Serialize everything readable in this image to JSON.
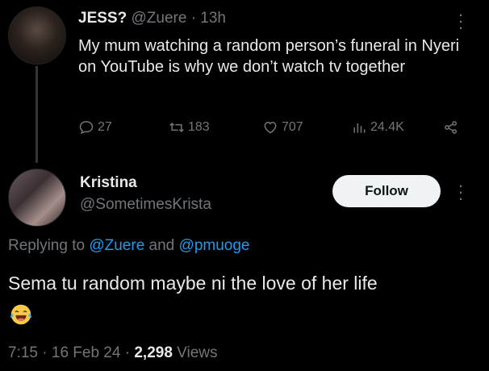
{
  "parent_tweet": {
    "display_name": "JESS?",
    "handle": "@Zuere",
    "separator": "·",
    "time": "13h",
    "text": "My mum watching a random person’s funeral in Nyeri on YouTube is why we don’t watch tv together",
    "actions": {
      "replies": "27",
      "retweets": "183",
      "likes": "707",
      "views": "24.4K"
    }
  },
  "reply_tweet": {
    "display_name": "Kristina",
    "handle": "@SometimesKrista",
    "follow_label": "Follow",
    "replying_prefix": "Replying to",
    "replying_to_1": "@Zuere",
    "replying_and": "and",
    "replying_to_2": "@pmuoge",
    "text": "Sema tu random maybe ni the love of her life",
    "emoji_name": "face-with-tears-of-joy-icon",
    "time": "7:15",
    "separator": "·",
    "date": "16 Feb 24",
    "views_count": "2,298",
    "views_label": "Views"
  },
  "colors": {
    "background": "#000000",
    "text_primary": "#e7e9ea",
    "text_secondary": "#71767b",
    "link": "#1d9bf0",
    "follow_bg": "#eff3f4"
  }
}
